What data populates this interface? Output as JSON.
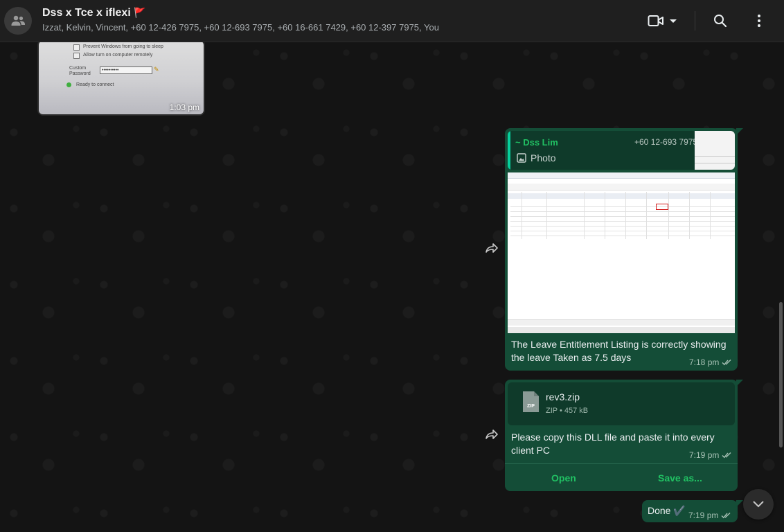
{
  "header": {
    "title": "Dss x Tce x iflexi",
    "title_flag": "🚩",
    "members": "Izzat, Kelvin, Vincent, +60 12-426 7975, +60 12-693 7975, +60 16-661 7429, +60 12-397 7975, You",
    "icons": [
      "group-avatar-icon",
      "video-call-icon",
      "chevron-down-icon",
      "search-icon",
      "kebab-menu-icon"
    ]
  },
  "colors": {
    "header_bg": "#1f1f1f",
    "chat_bg": "#141414",
    "outgoing_bubble": "#144d37",
    "quote_bg": "#0f3a2a",
    "accent_green": "#21c063",
    "highlight_red": "#d21b1b"
  },
  "messages": {
    "incoming_photo": {
      "screenshot_lines": [
        "Prevent Windows from going to sleep",
        "Allow turn on computer remotely",
        "Custom",
        "Password",
        "Ready to connect"
      ],
      "password_mask": "••••••••••",
      "time": "1:03 pm"
    },
    "leave_listing": {
      "reply_author": "~ Dss Lim",
      "reply_phone": "+60 12-693 7975",
      "reply_type": "Photo",
      "text_line1": "The Leave Entitlement Listing is correctly showing",
      "text_line2": "the leave Taken as 7.5 days",
      "time": "7:18 pm",
      "status_icon": "double-check-icon"
    },
    "zip_file": {
      "file_name": "rev3.zip",
      "file_type_badge": "ZIP",
      "file_info": "ZIP • 457 kB",
      "text_line1": "Please copy this DLL file and paste it into every",
      "text_line2": "client PC",
      "time": "7:19 pm",
      "open_label": "Open",
      "save_label": "Save as..."
    },
    "done": {
      "text": "Done",
      "emoji": "✔️",
      "time": "7:19 pm"
    }
  }
}
